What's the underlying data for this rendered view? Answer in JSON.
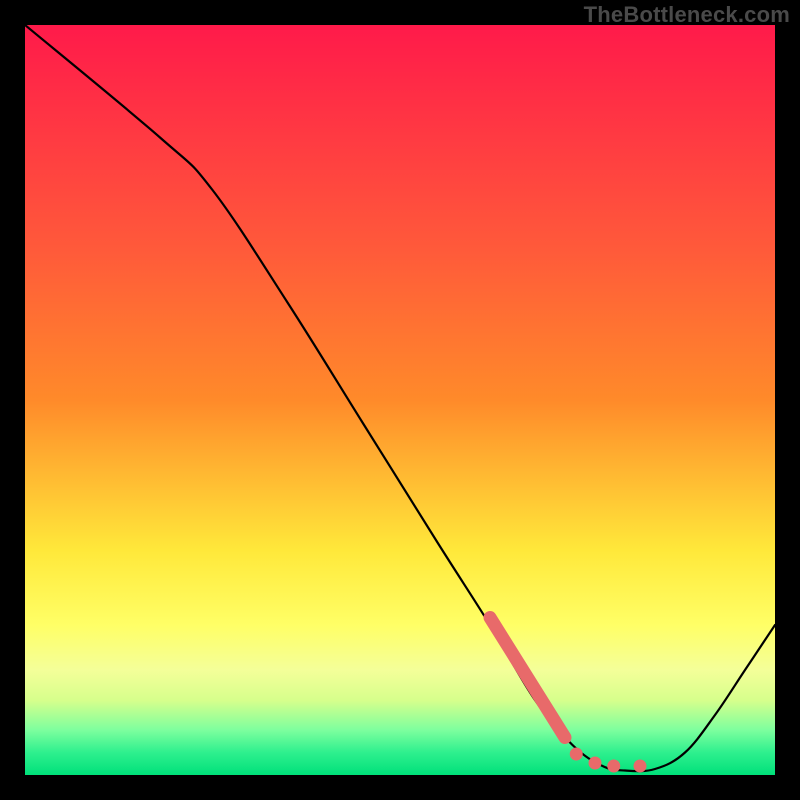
{
  "watermark": "TheBottleneck.com",
  "colors": {
    "frame": "#000000",
    "gradient_top": "#ff1a4a",
    "gradient_mid1": "#ff8a2a",
    "gradient_mid2": "#ffe83a",
    "gradient_green1": "#d7ff8c",
    "gradient_green2": "#7dff9e",
    "gradient_bottom": "#00e07a",
    "curve": "#000000",
    "marker": "#e86a6a"
  },
  "chart_data": {
    "type": "line",
    "title": "",
    "xlabel": "",
    "ylabel": "",
    "xlim": [
      0,
      100
    ],
    "ylim": [
      0,
      100
    ],
    "grid": false,
    "curve": [
      {
        "x": 0,
        "y": 100
      },
      {
        "x": 18,
        "y": 85
      },
      {
        "x": 25,
        "y": 78
      },
      {
        "x": 35,
        "y": 63
      },
      {
        "x": 45,
        "y": 47
      },
      {
        "x": 55,
        "y": 31
      },
      {
        "x": 62,
        "y": 20
      },
      {
        "x": 68,
        "y": 10
      },
      {
        "x": 73,
        "y": 4
      },
      {
        "x": 77,
        "y": 1.2
      },
      {
        "x": 80,
        "y": 0.6
      },
      {
        "x": 84,
        "y": 0.8
      },
      {
        "x": 88,
        "y": 3
      },
      {
        "x": 92,
        "y": 8
      },
      {
        "x": 96,
        "y": 14
      },
      {
        "x": 100,
        "y": 20
      }
    ],
    "highlight_segment": {
      "start": {
        "x": 62,
        "y": 21
      },
      "end": {
        "x": 72,
        "y": 5
      }
    },
    "highlight_dots": [
      {
        "x": 73.5,
        "y": 2.8
      },
      {
        "x": 76,
        "y": 1.6
      },
      {
        "x": 78.5,
        "y": 1.2
      },
      {
        "x": 82,
        "y": 1.2
      }
    ]
  }
}
